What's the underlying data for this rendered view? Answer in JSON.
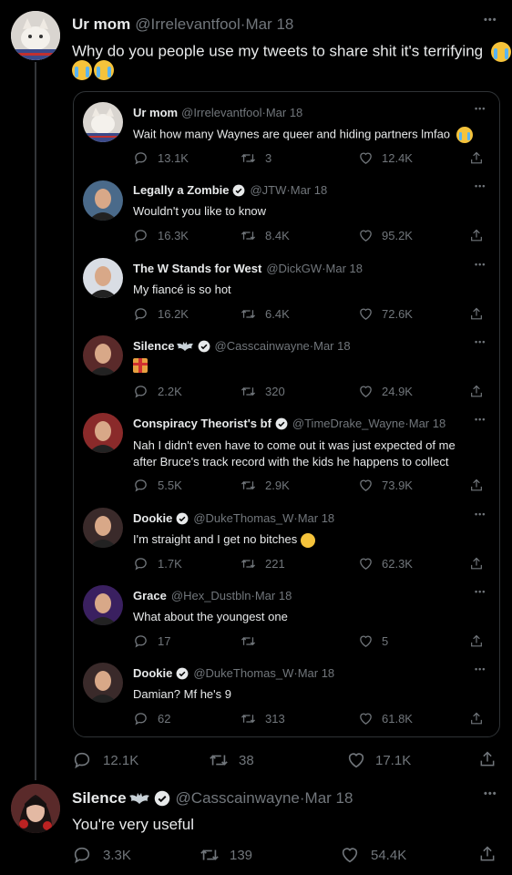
{
  "main": {
    "name": "Ur mom",
    "handle": "@Irrelevantfool",
    "date": "Mar 18",
    "text": "Why do you people use my tweets to share shit it's terrifying",
    "replies": "12.1K",
    "retweets": "38",
    "likes": "17.1K"
  },
  "quote": {
    "name": "Ur mom",
    "handle": "@Irrelevantfool",
    "date": "Mar 18",
    "text": "Wait how many Waynes are queer and hiding partners lmfao",
    "replies": "13.1K",
    "retweets": "3",
    "likes": "12.4K"
  },
  "replies_in_quote": [
    {
      "name": "Legally a Zombie",
      "handle": "@JTW",
      "date": "Mar 18",
      "text1": "Wouldn't you like to know",
      "text2": "",
      "replies": "16.3K",
      "retweets": "8.4K",
      "likes": "95.2K"
    },
    {
      "name": "The W Stands for West",
      "handle": "@DickGW",
      "date": "Mar 18",
      "text1": "My fiancé is so hot",
      "text2": "",
      "replies": "16.2K",
      "retweets": "6.4K",
      "likes": "72.6K"
    },
    {
      "name": "Silence",
      "handle": "@Casscainwayne",
      "date": "Mar 18",
      "text1": "",
      "text2": "",
      "replies": "2.2K",
      "retweets": "320",
      "likes": "24.9K"
    },
    {
      "name": "Conspiracy Theorist's bf",
      "handle": "@TimeDrake_Wayne",
      "date": "Mar 18",
      "text1": "Nah I didn't even have to come out it was just expected of me",
      "text2": "after Bruce's track record with the kids he happens to collect",
      "replies": "5.5K",
      "retweets": "2.9K",
      "likes": "73.9K"
    },
    {
      "name": "Dookie",
      "handle": "@DukeThomas_W",
      "date": "Mar 18",
      "text1": "I'm straight and I get no bitches",
      "text2": "",
      "replies": "1.7K",
      "retweets": "221",
      "likes": "62.3K"
    },
    {
      "name": "Grace",
      "handle": "@Hex_Dustbln",
      "date": "Mar 18",
      "text1": "What about the youngest one",
      "text2": "",
      "replies": "17",
      "retweets": "",
      "likes": "5"
    },
    {
      "name": "Dookie",
      "handle": "@DukeThomas_W",
      "date": "Mar 18",
      "text1": "Damian? Mf he's 9",
      "text2": "",
      "replies": "62",
      "retweets": "313",
      "likes": "61.8K"
    }
  ],
  "bottom": {
    "name": "Silence",
    "handle": "@Casscainwayne",
    "date": "Mar 18",
    "text": "You're very useful",
    "replies": "3.3K",
    "retweets": "139",
    "likes": "54.4K"
  },
  "sep": " · ",
  "dots": "•••"
}
